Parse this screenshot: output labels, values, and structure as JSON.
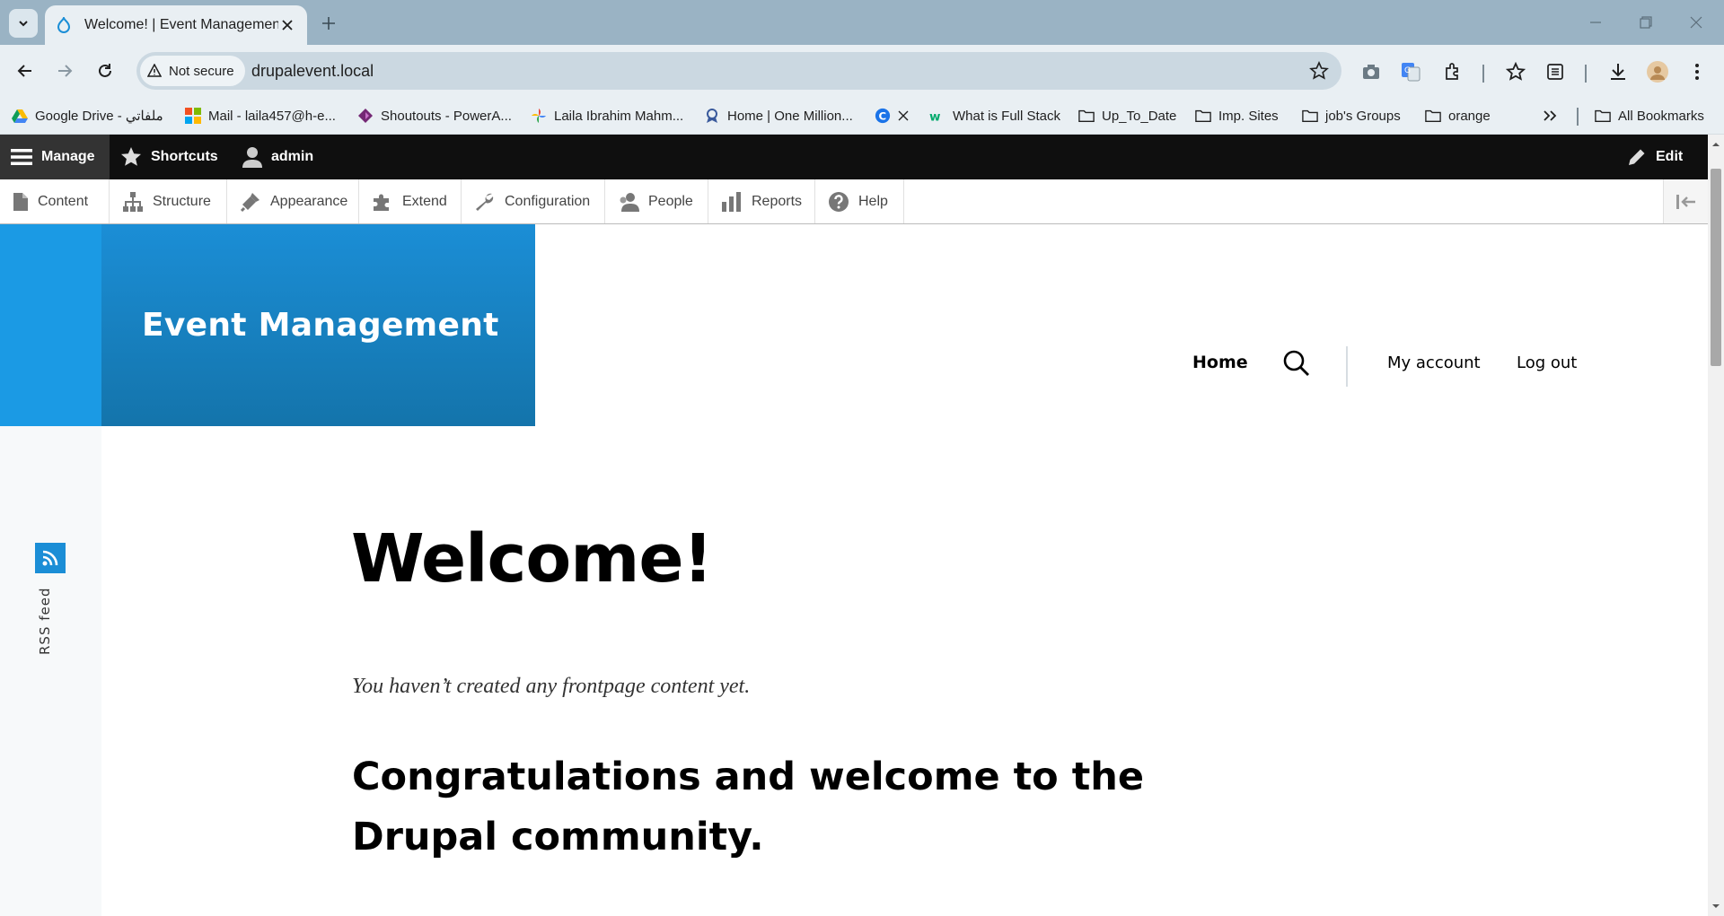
{
  "browser": {
    "tab_title": "Welcome! | Event Management",
    "security_label": "Not secure",
    "url": "drupalevent.local",
    "bookmarks": [
      {
        "label": "Google Drive - ملفاتي",
        "icon": "google-drive-icon"
      },
      {
        "label": "Mail - laila457@h-e...",
        "icon": "microsoft-icon"
      },
      {
        "label": "Shoutouts - PowerA...",
        "icon": "powerapps-icon"
      },
      {
        "label": "Laila Ibrahim Mahm...",
        "icon": "pinwheel-icon"
      },
      {
        "label": "Home | One Million...",
        "icon": "badge-icon"
      },
      {
        "label": "",
        "icon": "c-logo-icon"
      },
      {
        "label": "What is Full Stack",
        "icon": "w3-icon"
      },
      {
        "label": "Up_To_Date",
        "icon": "folder-icon"
      },
      {
        "label": "Imp. Sites",
        "icon": "folder-icon"
      },
      {
        "label": "job's Groups",
        "icon": "folder-icon"
      },
      {
        "label": "orange",
        "icon": "folder-icon"
      }
    ],
    "all_bookmarks": "All Bookmarks"
  },
  "admin_toolbar": {
    "manage": "Manage",
    "shortcuts": "Shortcuts",
    "user": "admin",
    "edit": "Edit",
    "tray": [
      {
        "label": "Content",
        "icon": "file-icon"
      },
      {
        "label": "Structure",
        "icon": "sitemap-icon"
      },
      {
        "label": "Appearance",
        "icon": "paintbrush-icon"
      },
      {
        "label": "Extend",
        "icon": "puzzle-icon"
      },
      {
        "label": "Configuration",
        "icon": "wrench-icon"
      },
      {
        "label": "People",
        "icon": "person-icon"
      },
      {
        "label": "Reports",
        "icon": "bar-chart-icon"
      },
      {
        "label": "Help",
        "icon": "question-icon"
      }
    ]
  },
  "site": {
    "name": "Event Management",
    "nav": {
      "home": "Home",
      "my_account": "My account",
      "log_out": "Log out"
    },
    "rss_label": "RSS feed"
  },
  "main": {
    "title": "Welcome!",
    "empty_message": "You haven’t created any frontpage content yet.",
    "congrats": "Congratulations and welcome to the Drupal community."
  },
  "colors": {
    "brand_blue": "#1b8ed6",
    "admin_bar": "#0f0f0f",
    "chrome_tab_strip": "#9ab3c4"
  }
}
